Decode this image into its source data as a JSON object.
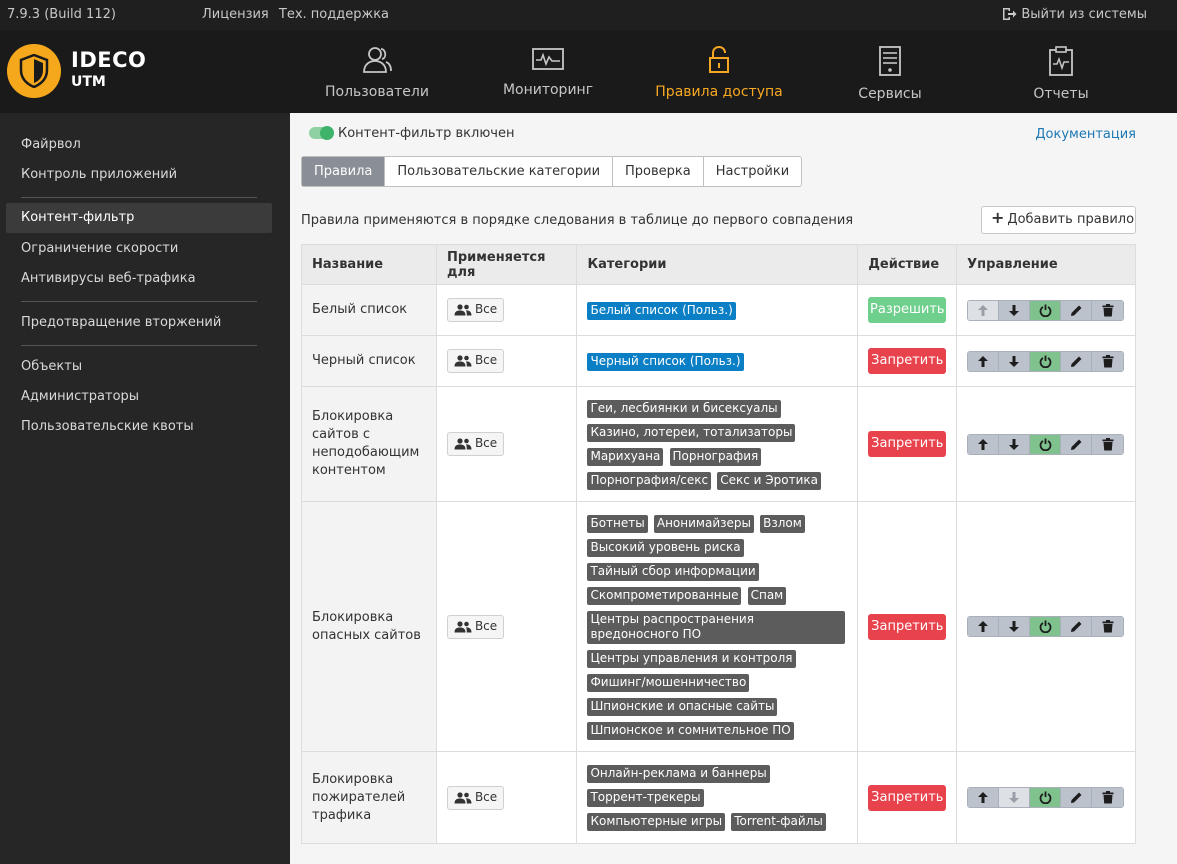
{
  "topbar": {
    "version": "7.9.3 (Build 112)",
    "license": "Лицензия",
    "support": "Тех. поддержка",
    "logout": "Выйти из системы"
  },
  "brand": {
    "line1": "IDECO",
    "line2": "UTM"
  },
  "nav": [
    {
      "label": "Пользователи",
      "icon": "users-icon"
    },
    {
      "label": "Мониторинг",
      "icon": "monitor-icon"
    },
    {
      "label": "Правила доступа",
      "icon": "unlock-icon",
      "active": true
    },
    {
      "label": "Сервисы",
      "icon": "server-icon"
    },
    {
      "label": "Отчеты",
      "icon": "report-icon"
    }
  ],
  "sidebar": {
    "items": [
      "Файрвол",
      "Контроль приложений",
      "Контент-фильтр",
      "Ограничение скорости",
      "Антивирусы веб-трафика",
      "Предотвращение вторжений",
      "Объекты",
      "Администраторы",
      "Пользовательские квоты"
    ],
    "active": "Контент-фильтр"
  },
  "content": {
    "toggle_label": "Контент-фильтр включен",
    "doc_link": "Документация",
    "tabs": [
      "Правила",
      "Пользовательские категории",
      "Проверка",
      "Настройки"
    ],
    "hint": "Правила применяются в порядке следования в таблице до первого совпадения",
    "add_rule": "Добавить правило"
  },
  "table": {
    "headers": [
      "Название",
      "Применяется для",
      "Категории",
      "Действие",
      "Управление"
    ],
    "rows": [
      {
        "name": "Белый список",
        "applies": "Все",
        "categories": [
          "Белый список (Польз.)"
        ],
        "category_color": "blue",
        "action": "Разрешить",
        "action_type": "allow"
      },
      {
        "name": "Черный список",
        "applies": "Все",
        "categories": [
          "Черный список (Польз.)"
        ],
        "category_color": "blue",
        "action": "Запретить",
        "action_type": "deny"
      },
      {
        "name": "Блокировка сайтов с неподобающим контентом",
        "applies": "Все",
        "categories": [
          "Геи, лесбиянки и бисексуалы",
          "Казино, лотереи, тотализаторы",
          "Марихуана",
          "Порнография",
          "Порнография/секс",
          "Секс и Эротика"
        ],
        "category_color": "gray",
        "action": "Запретить",
        "action_type": "deny"
      },
      {
        "name": "Блокировка опасных сайтов",
        "applies": "Все",
        "categories": [
          "Ботнеты",
          "Анонимайзеры",
          "Взлом",
          "Высокий уровень риска",
          "Тайный сбор информации",
          "Скомпрометированные",
          "Спам",
          "Центры распространения вредоносного ПО",
          "Центры управления и контроля",
          "Фишинг/мошенничество",
          "Шпионские и опасные сайты",
          "Шпионское и сомнительное ПО"
        ],
        "category_color": "gray",
        "action": "Запретить",
        "action_type": "deny"
      },
      {
        "name": "Блокировка пожирателей трафика",
        "applies": "Все",
        "categories": [
          "Онлайн-реклама и баннеры",
          "Торрент-трекеры",
          "Компьютерные игры",
          "Torrent-файлы"
        ],
        "category_color": "gray",
        "action": "Запретить",
        "action_type": "deny"
      }
    ]
  }
}
